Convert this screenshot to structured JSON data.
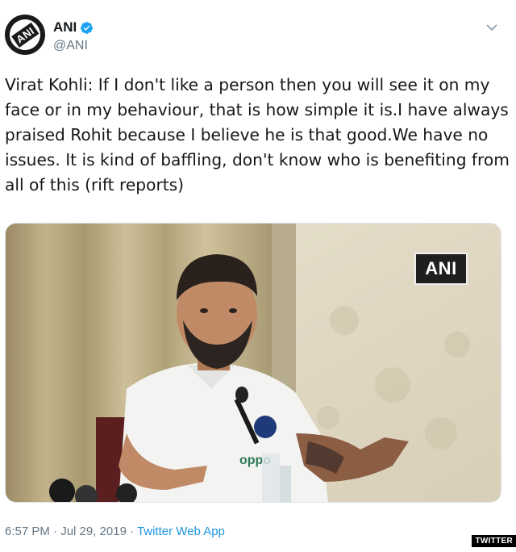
{
  "author": {
    "display_name": "ANI",
    "handle": "@ANI",
    "avatar_text": "ANI",
    "verified": true
  },
  "tweet": {
    "text": "Virat Kohli: If I don't like a person then you will see it on my face or in my behaviour, that is how simple it is.I have always praised Rohit because I believe he is that good.We have no issues. It is kind of baffling, don't know who is benefiting from all of this (rift reports)"
  },
  "media": {
    "watermark": "ANI",
    "jersey_text": "oppo"
  },
  "footer": {
    "timestamp": "6:57 PM · Jul 29, 2019",
    "separator": "·",
    "source": "Twitter Web App"
  },
  "badge": "TWITTER",
  "colors": {
    "link": "#1b95e0",
    "verified": "#1da1f2",
    "muted": "#657786"
  }
}
